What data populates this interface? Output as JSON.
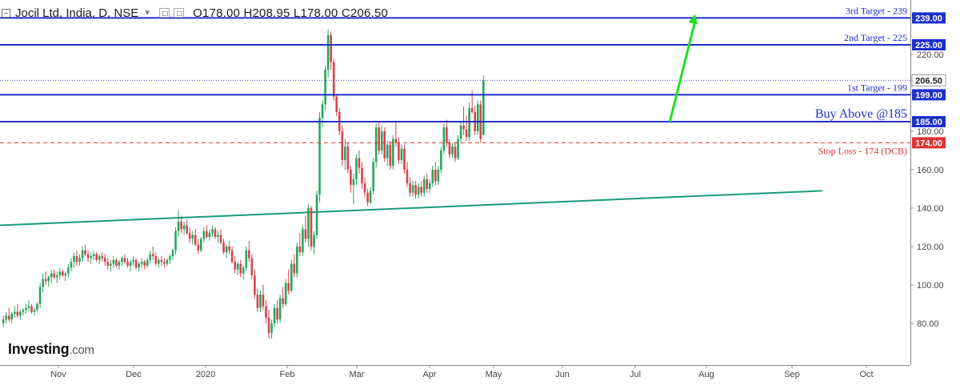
{
  "header": {
    "symbol": "Jocil Ltd, India, D, NSE",
    "ohlc": "O178.00  H208.95  L178.00  C206.50"
  },
  "logo": {
    "brand": "Investing",
    "domain": ".com"
  },
  "colors": {
    "up": "#26a65b",
    "down": "#d9414e",
    "level": "#1f2fc9",
    "trend": "#1a9a7a",
    "stop": "#e03030",
    "arrow": "#22dd22",
    "axis": "#888888"
  },
  "chart_data": {
    "type": "candlestick",
    "title": "Jocil Ltd, India, D, NSE",
    "ylim": [
      60,
      246
    ],
    "y_ticks": [
      80,
      100,
      120,
      140,
      160,
      180,
      200,
      220
    ],
    "x_ticks": [
      "Nov",
      "Dec",
      "2020",
      "Feb",
      "Mar",
      "Apr",
      "May",
      "Jun",
      "Jul",
      "Aug",
      "Sep",
      "Oct"
    ],
    "grid": false,
    "last_close": 206.5,
    "candles": [
      [
        80,
        84,
        78,
        82
      ],
      [
        82,
        86,
        80,
        84
      ],
      [
        84,
        88,
        81,
        82
      ],
      [
        82,
        86,
        80,
        85
      ],
      [
        85,
        89,
        83,
        86
      ],
      [
        86,
        90,
        83,
        84
      ],
      [
        84,
        87,
        82,
        86
      ],
      [
        86,
        88,
        84,
        87
      ],
      [
        87,
        90,
        85,
        88
      ],
      [
        88,
        92,
        86,
        89
      ],
      [
        89,
        90,
        85,
        86
      ],
      [
        86,
        88,
        84,
        87
      ],
      [
        87,
        91,
        86,
        90
      ],
      [
        90,
        101,
        88,
        99
      ],
      [
        99,
        106,
        96,
        103
      ],
      [
        103,
        107,
        100,
        102
      ],
      [
        102,
        105,
        99,
        104
      ],
      [
        104,
        108,
        101,
        106
      ],
      [
        106,
        108,
        103,
        104
      ],
      [
        104,
        107,
        101,
        105
      ],
      [
        105,
        109,
        103,
        107
      ],
      [
        107,
        108,
        104,
        105
      ],
      [
        105,
        107,
        102,
        106
      ],
      [
        106,
        111,
        104,
        109
      ],
      [
        109,
        114,
        107,
        112
      ],
      [
        112,
        117,
        109,
        115
      ],
      [
        115,
        118,
        110,
        112
      ],
      [
        112,
        116,
        110,
        114
      ],
      [
        114,
        120,
        112,
        118
      ],
      [
        118,
        121,
        115,
        116
      ],
      [
        116,
        118,
        112,
        114
      ],
      [
        114,
        117,
        111,
        115
      ],
      [
        115,
        118,
        113,
        116
      ],
      [
        116,
        117,
        112,
        113
      ],
      [
        113,
        116,
        111,
        115
      ],
      [
        115,
        117,
        112,
        114
      ],
      [
        114,
        116,
        110,
        112
      ],
      [
        112,
        114,
        108,
        110
      ],
      [
        110,
        113,
        107,
        111
      ],
      [
        111,
        115,
        109,
        113
      ],
      [
        113,
        114,
        109,
        110
      ],
      [
        110,
        113,
        108,
        112
      ],
      [
        112,
        115,
        110,
        114
      ],
      [
        114,
        116,
        111,
        112
      ],
      [
        112,
        114,
        109,
        110
      ],
      [
        110,
        113,
        107,
        112
      ],
      [
        112,
        115,
        110,
        113
      ],
      [
        113,
        114,
        108,
        109
      ],
      [
        109,
        112,
        107,
        111
      ],
      [
        111,
        114,
        109,
        112
      ],
      [
        112,
        113,
        108,
        110
      ],
      [
        110,
        114,
        109,
        113
      ],
      [
        113,
        118,
        111,
        116
      ],
      [
        116,
        120,
        113,
        115
      ],
      [
        115,
        117,
        110,
        111
      ],
      [
        111,
        114,
        109,
        113
      ],
      [
        113,
        115,
        110,
        112
      ],
      [
        112,
        114,
        109,
        111
      ],
      [
        111,
        114,
        110,
        113
      ],
      [
        113,
        116,
        111,
        115
      ],
      [
        115,
        119,
        113,
        118
      ],
      [
        118,
        130,
        116,
        128
      ],
      [
        128,
        139,
        125,
        133
      ],
      [
        133,
        136,
        127,
        129
      ],
      [
        129,
        133,
        126,
        131
      ],
      [
        131,
        134,
        126,
        127
      ],
      [
        127,
        130,
        122,
        124
      ],
      [
        124,
        128,
        121,
        126
      ],
      [
        126,
        129,
        120,
        121
      ],
      [
        121,
        124,
        116,
        118
      ],
      [
        118,
        125,
        117,
        124
      ],
      [
        124,
        130,
        122,
        128
      ],
      [
        128,
        131,
        124,
        125
      ],
      [
        125,
        129,
        123,
        127
      ],
      [
        127,
        131,
        125,
        129
      ],
      [
        129,
        130,
        124,
        125
      ],
      [
        125,
        128,
        122,
        126
      ],
      [
        126,
        129,
        121,
        122
      ],
      [
        122,
        124,
        116,
        117
      ],
      [
        117,
        121,
        114,
        120
      ],
      [
        120,
        123,
        116,
        118
      ],
      [
        118,
        120,
        111,
        112
      ],
      [
        112,
        115,
        106,
        108
      ],
      [
        108,
        112,
        105,
        111
      ],
      [
        111,
        113,
        104,
        106
      ],
      [
        106,
        110,
        103,
        109
      ],
      [
        109,
        120,
        107,
        118
      ],
      [
        118,
        123,
        112,
        114
      ],
      [
        114,
        116,
        103,
        105
      ],
      [
        105,
        108,
        93,
        95
      ],
      [
        95,
        98,
        86,
        88
      ],
      [
        88,
        97,
        86,
        95
      ],
      [
        95,
        100,
        87,
        89
      ],
      [
        89,
        92,
        80,
        83
      ],
      [
        83,
        87,
        72,
        75
      ],
      [
        75,
        82,
        72,
        80
      ],
      [
        80,
        90,
        78,
        88
      ],
      [
        88,
        92,
        80,
        82
      ],
      [
        82,
        95,
        80,
        93
      ],
      [
        93,
        99,
        88,
        90
      ],
      [
        90,
        103,
        89,
        101
      ],
      [
        101,
        108,
        95,
        97
      ],
      [
        97,
        113,
        96,
        111
      ],
      [
        111,
        116,
        104,
        106
      ],
      [
        106,
        122,
        104,
        120
      ],
      [
        120,
        127,
        115,
        117
      ],
      [
        117,
        131,
        115,
        129
      ],
      [
        129,
        136,
        122,
        124
      ],
      [
        124,
        142,
        120,
        140
      ],
      [
        140,
        141,
        118,
        120
      ],
      [
        120,
        128,
        116,
        126
      ],
      [
        126,
        149,
        124,
        147
      ],
      [
        147,
        190,
        143,
        187
      ],
      [
        187,
        196,
        182,
        194
      ],
      [
        194,
        214,
        191,
        212
      ],
      [
        212,
        233,
        208,
        230
      ],
      [
        230,
        232,
        212,
        216
      ],
      [
        216,
        218,
        196,
        198
      ],
      [
        198,
        199,
        188,
        190
      ],
      [
        190,
        192,
        178,
        180
      ],
      [
        180,
        183,
        162,
        165
      ],
      [
        165,
        176,
        160,
        172
      ],
      [
        172,
        174,
        158,
        160
      ],
      [
        160,
        162,
        148,
        152
      ],
      [
        152,
        158,
        142,
        155
      ],
      [
        155,
        168,
        152,
        166
      ],
      [
        166,
        170,
        158,
        161
      ],
      [
        161,
        164,
        150,
        153
      ],
      [
        153,
        156,
        146,
        148
      ],
      [
        148,
        150,
        141,
        143
      ],
      [
        143,
        151,
        142,
        149
      ],
      [
        149,
        166,
        147,
        164
      ],
      [
        164,
        184,
        161,
        182
      ],
      [
        182,
        185,
        168,
        170
      ],
      [
        170,
        183,
        168,
        180
      ],
      [
        180,
        182,
        164,
        166
      ],
      [
        166,
        175,
        162,
        173
      ],
      [
        173,
        175,
        160,
        162
      ],
      [
        162,
        178,
        160,
        176
      ],
      [
        176,
        185,
        172,
        174
      ],
      [
        174,
        177,
        163,
        165
      ],
      [
        165,
        173,
        163,
        171
      ],
      [
        171,
        173,
        158,
        160
      ],
      [
        160,
        164,
        151,
        153
      ],
      [
        153,
        156,
        146,
        148
      ],
      [
        148,
        154,
        146,
        152
      ],
      [
        152,
        154,
        145,
        147
      ],
      [
        147,
        153,
        145,
        151
      ],
      [
        151,
        154,
        146,
        148
      ],
      [
        148,
        157,
        146,
        155
      ],
      [
        155,
        158,
        148,
        150
      ],
      [
        150,
        155,
        148,
        153
      ],
      [
        153,
        162,
        151,
        160
      ],
      [
        160,
        164,
        152,
        154
      ],
      [
        154,
        162,
        152,
        160
      ],
      [
        160,
        172,
        158,
        170
      ],
      [
        170,
        184,
        168,
        182
      ],
      [
        182,
        186,
        172,
        174
      ],
      [
        174,
        176,
        166,
        168
      ],
      [
        168,
        174,
        166,
        172
      ],
      [
        172,
        174,
        164,
        166
      ],
      [
        166,
        178,
        165,
        176
      ],
      [
        176,
        185,
        174,
        183
      ],
      [
        183,
        193,
        178,
        181
      ],
      [
        181,
        188,
        175,
        177
      ],
      [
        177,
        195,
        175,
        192
      ],
      [
        192,
        201,
        189,
        190
      ],
      [
        190,
        193,
        178,
        180
      ],
      [
        180,
        196,
        178,
        194
      ],
      [
        194,
        196,
        174,
        176
      ],
      [
        178,
        209,
        178,
        206.5
      ]
    ],
    "trendline": [
      [
        -10,
        130.5
      ],
      [
        290,
        149
      ]
    ],
    "levels": [
      {
        "value": 239,
        "label": "3rd Target - 239",
        "badge": "239.00",
        "style": "solid"
      },
      {
        "value": 225,
        "label": "2nd Target - 225",
        "badge": "225.00",
        "style": "solid"
      },
      {
        "value": 199,
        "label": "1st Target - 199",
        "badge": "199.00",
        "style": "solid"
      },
      {
        "value": 185,
        "label": "Buy Above @185",
        "badge": "185.00",
        "style": "solid"
      },
      {
        "value": 174,
        "label": "Stop Loss - 174 (DCB)",
        "badge": "174.00",
        "style": "dashed"
      }
    ],
    "annotation_arrow": {
      "from": [
        236,
        185
      ],
      "to": [
        245,
        241
      ]
    }
  }
}
